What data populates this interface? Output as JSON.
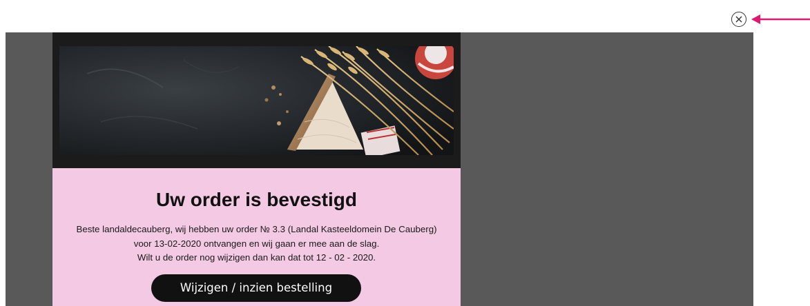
{
  "dialog": {
    "close_icon": "close-circle-icon",
    "annotation_icon": "arrow-left-icon",
    "annotation_color": "#e0196e"
  },
  "email": {
    "hero_image": "bread-and-wheat-on-slate",
    "title": "Uw order is bevestigd",
    "body_lines": [
      "Beste landaldecauberg, wij hebben uw order № 3.3 (Landal Kasteeldomein De Cauberg)",
      "voor 13-02-2020 ontvangen en wij gaan er mee aan de slag.",
      "Wilt u de order nog wijzigen dan kan dat tot 12 - 02 - 2020."
    ],
    "cta_label": "Wijzigen / inzien bestelling",
    "pink_bg": "#f3c9e3",
    "dark_bg": "#1b1b1b"
  },
  "colors": {
    "overlay": "#595959"
  }
}
